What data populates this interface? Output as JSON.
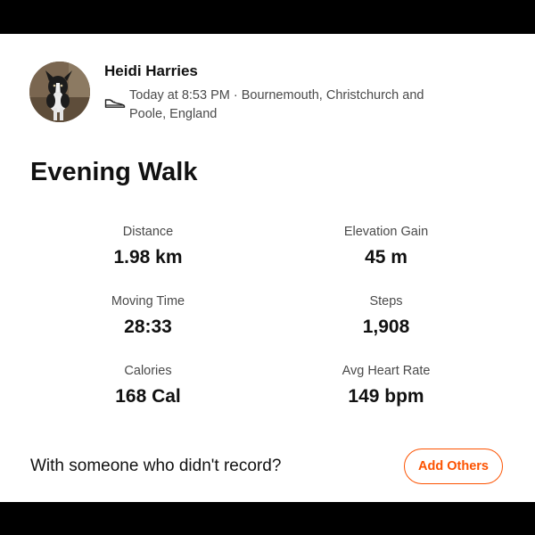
{
  "athlete": {
    "name": "Heidi Harries",
    "avatar": "dog-photo"
  },
  "activity": {
    "type_icon": "shoe-icon",
    "meta": "Today at 8:53 PM · Bournemouth, Christchurch and Poole, England",
    "title": "Evening Walk"
  },
  "stats": [
    {
      "label": "Distance",
      "value": "1.98 km"
    },
    {
      "label": "Elevation Gain",
      "value": "45 m"
    },
    {
      "label": "Moving Time",
      "value": "28:33"
    },
    {
      "label": "Steps",
      "value": "1,908"
    },
    {
      "label": "Calories",
      "value": "168 Cal"
    },
    {
      "label": "Avg Heart Rate",
      "value": "149 bpm"
    }
  ],
  "footer": {
    "prompt": "With someone who didn't record?",
    "add_others_label": "Add Others"
  },
  "colors": {
    "accent": "#fc5200",
    "text_primary": "#111111",
    "text_secondary": "#4a4a4a",
    "background": "#ffffff"
  }
}
